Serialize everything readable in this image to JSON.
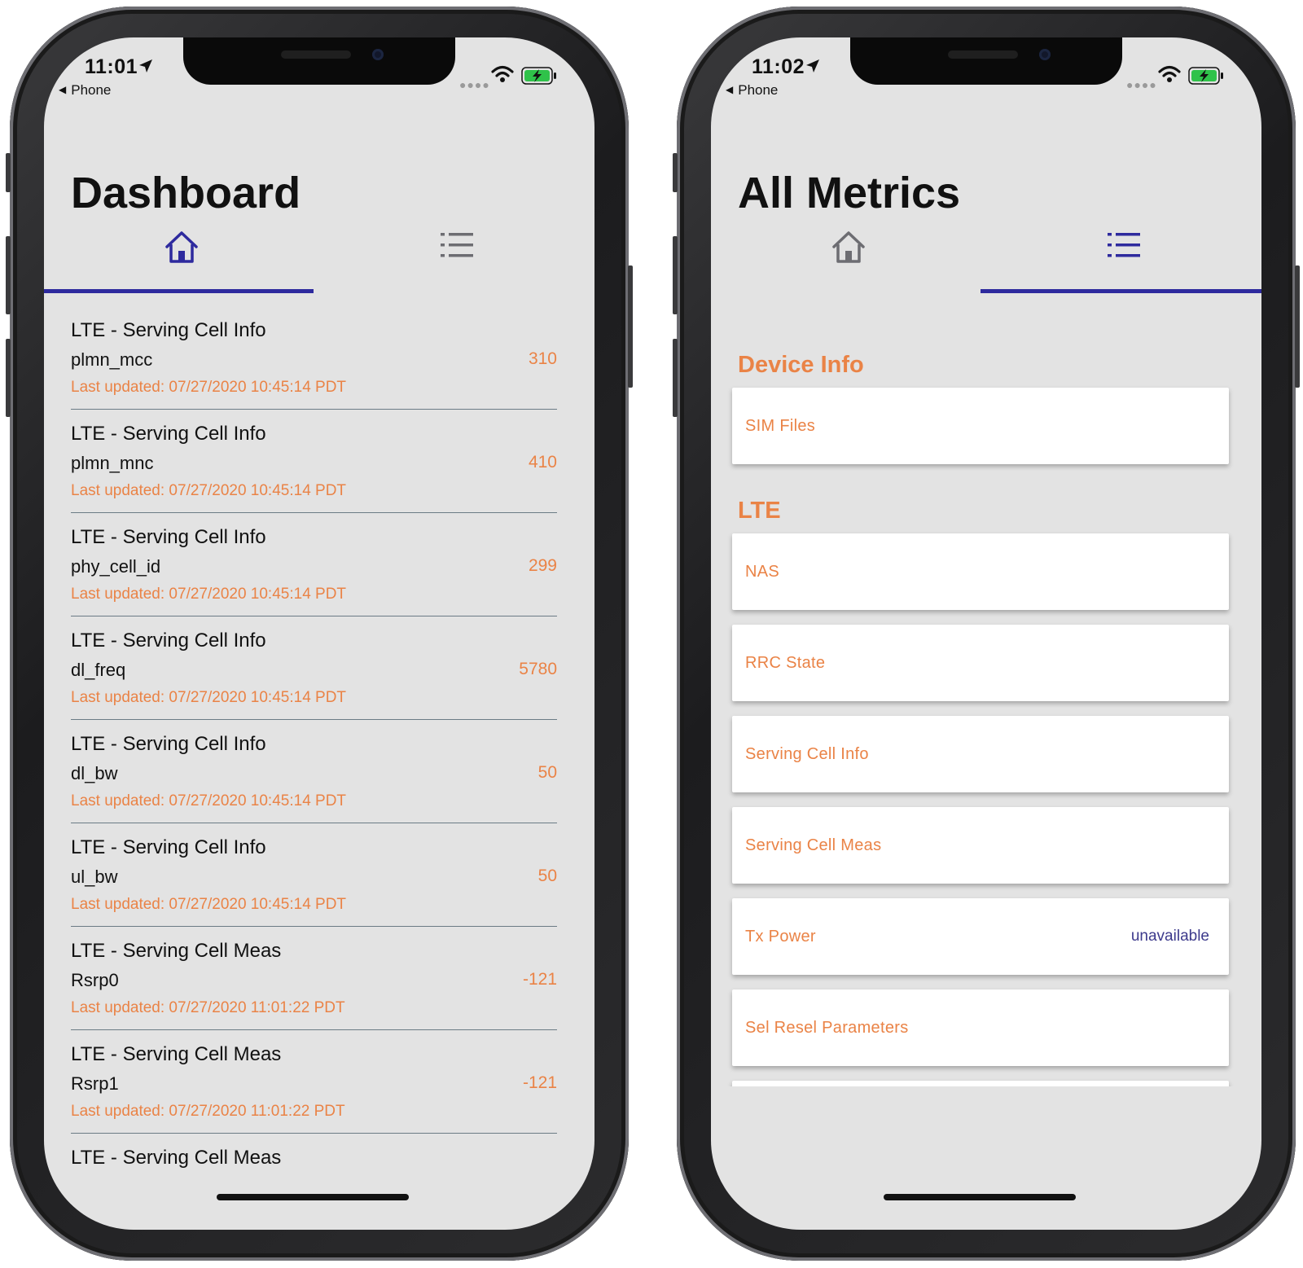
{
  "colors": {
    "accent": "#2e2a9e",
    "orange": "#ea8346",
    "screen_bg": "#e3e3e3",
    "divider": "#6b7b85"
  },
  "left_phone": {
    "status": {
      "time": "11:01",
      "back_label": "Phone"
    },
    "title": "Dashboard",
    "tabs": [
      {
        "icon": "home-icon",
        "selected": true
      },
      {
        "icon": "list-icon",
        "selected": false
      }
    ],
    "rows": [
      {
        "category": "LTE - Serving Cell Info",
        "metric": "plmn_mcc",
        "value": "310",
        "updated": "Last updated: 07/27/2020 10:45:14 PDT"
      },
      {
        "category": "LTE - Serving Cell Info",
        "metric": "plmn_mnc",
        "value": "410",
        "updated": "Last updated: 07/27/2020 10:45:14 PDT"
      },
      {
        "category": "LTE - Serving Cell Info",
        "metric": "phy_cell_id",
        "value": "299",
        "updated": "Last updated: 07/27/2020 10:45:14 PDT"
      },
      {
        "category": "LTE - Serving Cell Info",
        "metric": "dl_freq",
        "value": "5780",
        "updated": "Last updated: 07/27/2020 10:45:14 PDT"
      },
      {
        "category": "LTE - Serving Cell Info",
        "metric": "dl_bw",
        "value": "50",
        "updated": "Last updated: 07/27/2020 10:45:14 PDT"
      },
      {
        "category": "LTE - Serving Cell Info",
        "metric": "ul_bw",
        "value": "50",
        "updated": "Last updated: 07/27/2020 10:45:14 PDT"
      },
      {
        "category": "LTE - Serving Cell Meas",
        "metric": "Rsrp0",
        "value": "-121",
        "updated": "Last updated: 07/27/2020 11:01:22 PDT"
      },
      {
        "category": "LTE - Serving Cell Meas",
        "metric": "Rsrp1",
        "value": "-121",
        "updated": "Last updated: 07/27/2020 11:01:22 PDT"
      },
      {
        "category": "LTE - Serving Cell Meas",
        "metric": "",
        "value": "",
        "updated": ""
      }
    ]
  },
  "right_phone": {
    "status": {
      "time": "11:02",
      "back_label": "Phone"
    },
    "title": "All Metrics",
    "tabs": [
      {
        "icon": "home-icon",
        "selected": false
      },
      {
        "icon": "list-icon",
        "selected": true
      }
    ],
    "sections": [
      {
        "header": "Device Info",
        "items": [
          {
            "label": "SIM Files",
            "aux": ""
          }
        ]
      },
      {
        "header": "LTE",
        "items": [
          {
            "label": "NAS",
            "aux": ""
          },
          {
            "label": "RRC State",
            "aux": ""
          },
          {
            "label": "Serving Cell Info",
            "aux": ""
          },
          {
            "label": "Serving Cell Meas",
            "aux": ""
          },
          {
            "label": "Tx Power",
            "aux": "unavailable"
          },
          {
            "label": "Sel Resel Parameters",
            "aux": ""
          },
          {
            "label": "",
            "aux": ""
          }
        ]
      }
    ]
  }
}
